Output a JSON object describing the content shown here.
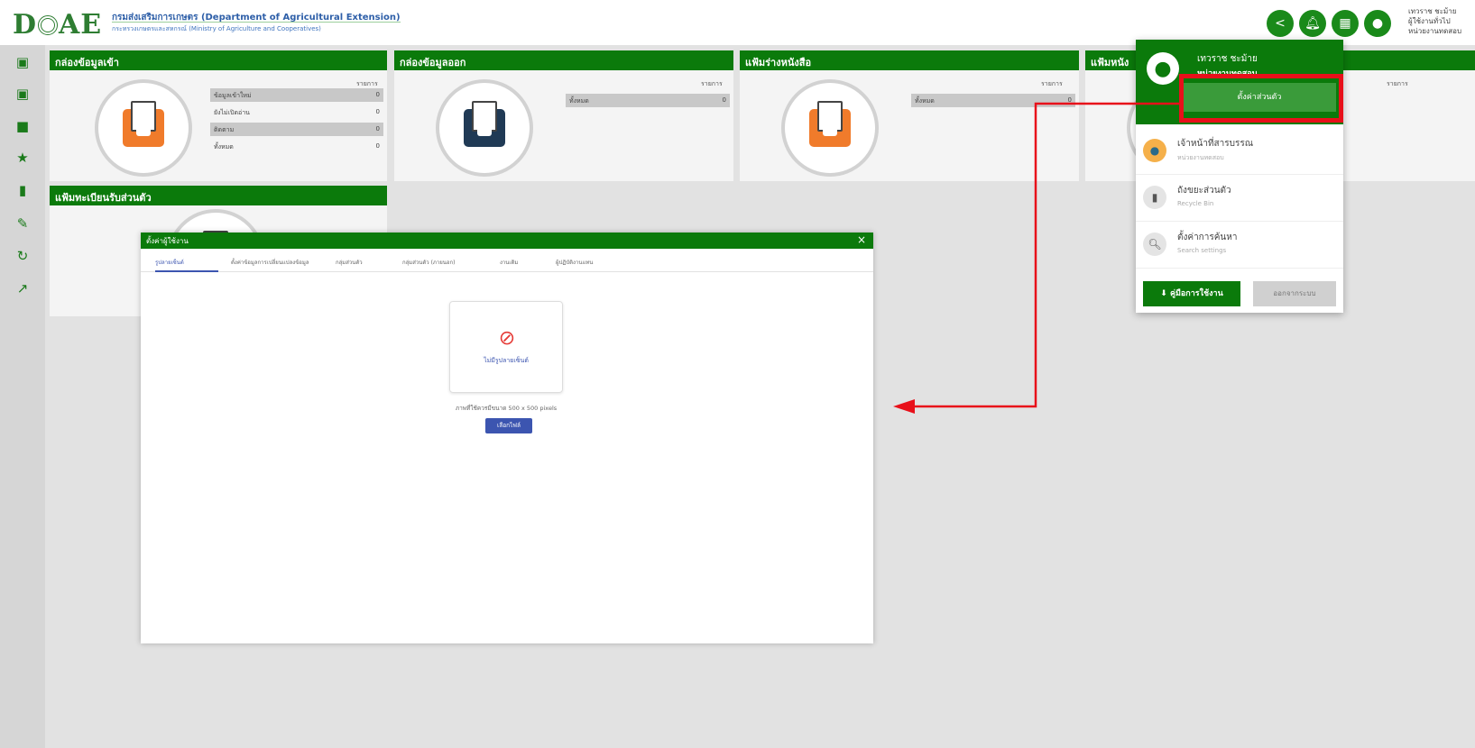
{
  "header": {
    "logo_text": "DOAE",
    "org_title": "กรมส่งเสริมการเกษตร (Department of Agricultural Extension)",
    "org_subtitle": "กระทรวงเกษตรและสหกรณ์ (Ministry of Agriculture and Cooperatives)",
    "user_line1": "เทวราช ชะม้าย",
    "user_line2": "ผู้ใช้งานทั่วไป",
    "user_line3": "หน่วยงานทดสอบ"
  },
  "panels": [
    {
      "title": "กล่องข้อมูลเข้า",
      "count_header": "รายการ",
      "rows": [
        {
          "label": "ข้อมูลเข้าใหม่",
          "value": "0"
        },
        {
          "label": "ยังไม่เปิดอ่าน",
          "value": "0"
        },
        {
          "label": "ติดตาม",
          "value": "0"
        },
        {
          "label": "ทั้งหมด",
          "value": "0"
        }
      ]
    },
    {
      "title": "กล่องข้อมูลออก",
      "count_header": "รายการ",
      "rows": [
        {
          "label": "ทั้งหมด",
          "value": "0"
        }
      ]
    },
    {
      "title": "แฟ้มร่างหนังสือ",
      "count_header": "รายการ",
      "rows": [
        {
          "label": "ทั้งหมด",
          "value": "0"
        }
      ]
    },
    {
      "title": "แฟ้มหนัง",
      "count_header": "รายการ"
    },
    {
      "title": "แฟ้มทะเบียนรับส่วนตัว"
    }
  ],
  "modal": {
    "title": "ตั้งค่าผู้ใช้งาน",
    "close_label": "×",
    "tabs": [
      "รูปลายเซ็นต์",
      "ตั้งค่าข้อมูลการเปลี่ยนแปลงข้อมูล",
      "กลุ่มส่วนตัว",
      "กลุ่มส่วนตัว (ภายนอก)",
      "งานเดิม",
      "ผู้ปฏิบัติงานแทน"
    ],
    "no_signature_text": "ไม่มีรูปลายเซ็นต์",
    "hint_text": "ภาพที่ใช้ควรมีขนาด 500 x 500 pixels",
    "upload_label": "เลือกไฟล์"
  },
  "dropdown": {
    "user_name": "เทวราช ชะม้าย",
    "unit": "หน่วยงานทดสอบ",
    "settings_label": "ตั้งค่าส่วนตัว",
    "items": [
      {
        "title": "เจ้าหน้าที่สารบรรณ",
        "sub": "หน่วยงานทดสอบ"
      },
      {
        "title": "ถังขยะส่วนตัว",
        "sub": "Recycle Bin"
      },
      {
        "title": "ตั้งค่าการค้นหา",
        "sub": "Search settings"
      }
    ],
    "manual_label": "คู่มือการใช้งาน",
    "logout_label": "ออกจากระบบ"
  },
  "colors": {
    "primary_green": "#0b7a0b",
    "annotation_red": "#e8101a",
    "accent_blue": "#3c55b0",
    "folder_orange": "#f07b2b"
  }
}
